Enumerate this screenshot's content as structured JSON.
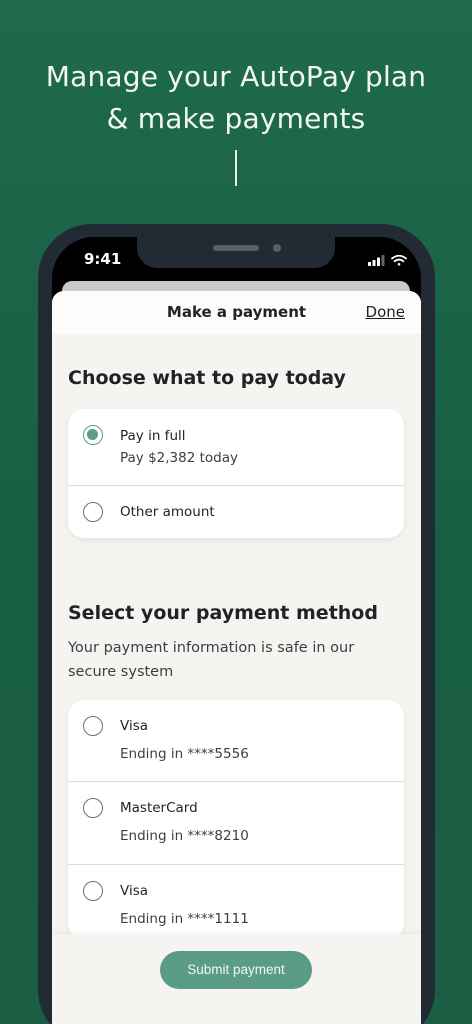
{
  "hero": {
    "line1": "Manage your AutoPay plan",
    "line2": "& make payments"
  },
  "status_bar": {
    "time": "9:41",
    "icons": [
      "signal-icon",
      "wifi-icon"
    ]
  },
  "sheet": {
    "title": "Make a payment",
    "done_label": "Done"
  },
  "pay_section": {
    "title": "Choose what to pay today",
    "options": [
      {
        "label": "Pay in full",
        "sub": "Pay $2,382 today",
        "selected": true
      },
      {
        "label": "Other amount",
        "sub": "",
        "selected": false
      }
    ]
  },
  "method_section": {
    "title": "Select your payment method",
    "subtitle": "Your payment information is safe in our secure system",
    "methods": [
      {
        "label": "Visa",
        "sub": "Ending in ****5556",
        "selected": false
      },
      {
        "label": "MasterCard",
        "sub": "Ending in ****8210",
        "selected": false
      },
      {
        "label": "Visa",
        "sub": "Ending in ****1111",
        "selected": false
      }
    ]
  },
  "footer": {
    "submit_label": "Submit payment"
  },
  "colors": {
    "background_green": "#1a6246",
    "accent": "#5a9c88",
    "sheet_bg": "#f6f4f1"
  }
}
